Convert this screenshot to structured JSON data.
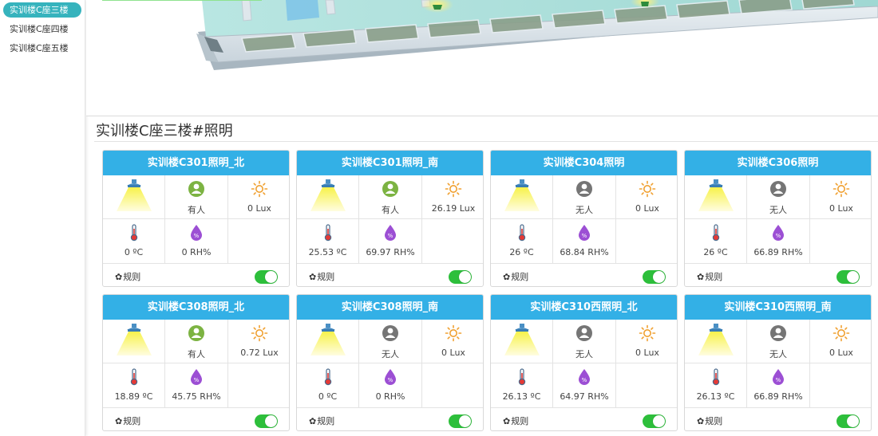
{
  "sidebar": {
    "items": [
      {
        "label": "实训楼C座三楼",
        "active": true
      },
      {
        "label": "实训楼C座四楼",
        "active": false
      },
      {
        "label": "实训楼C座五楼",
        "active": false
      }
    ]
  },
  "section": {
    "title": "实训楼C座三楼#照明"
  },
  "colors": {
    "header": "#33b0e6",
    "active_nav": "#36b3bd",
    "toggle_on": "#2dbf3b",
    "occupied": "#7cb342",
    "vacant": "#757575",
    "humidity": "#9c4fd4",
    "sun": "#f0a030"
  },
  "rule_label": "规则",
  "cards": [
    {
      "title": "实训楼C301照明_北",
      "occupancy": "有人",
      "lux": "0 Lux",
      "temp": "0 ºC",
      "humidity": "0 RH%",
      "switch_on": true
    },
    {
      "title": "实训楼C301照明_南",
      "occupancy": "有人",
      "lux": "26.19 Lux",
      "temp": "25.53 ºC",
      "humidity": "69.97 RH%",
      "switch_on": true
    },
    {
      "title": "实训楼C304照明",
      "occupancy": "无人",
      "lux": "0 Lux",
      "temp": "26 ºC",
      "humidity": "68.84 RH%",
      "switch_on": true
    },
    {
      "title": "实训楼C306照明",
      "occupancy": "无人",
      "lux": "0 Lux",
      "temp": "26 ºC",
      "humidity": "66.89 RH%",
      "switch_on": true
    },
    {
      "title": "实训楼C308照明_北",
      "occupancy": "有人",
      "lux": "0.72 Lux",
      "temp": "18.89 ºC",
      "humidity": "45.75 RH%",
      "switch_on": true
    },
    {
      "title": "实训楼C308照明_南",
      "occupancy": "无人",
      "lux": "0 Lux",
      "temp": "0 ºC",
      "humidity": "0 RH%",
      "switch_on": true
    },
    {
      "title": "实训楼C310西照明_北",
      "occupancy": "无人",
      "lux": "0 Lux",
      "temp": "26.13 ºC",
      "humidity": "64.97 RH%",
      "switch_on": true
    },
    {
      "title": "实训楼C310西照明_南",
      "occupancy": "无人",
      "lux": "0 Lux",
      "temp": "26.13 ºC",
      "humidity": "66.89 RH%",
      "switch_on": true
    }
  ]
}
